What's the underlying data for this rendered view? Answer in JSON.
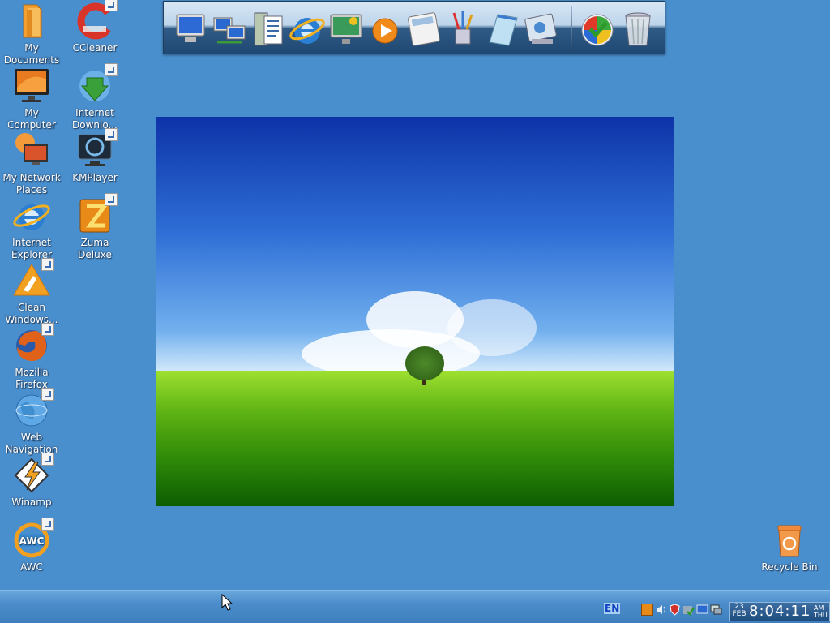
{
  "desktop": {
    "icons": [
      {
        "label": "My\nDocuments",
        "icon": "folder-icon",
        "shortcut": false
      },
      {
        "label": "My Computer",
        "icon": "computer-icon",
        "shortcut": false
      },
      {
        "label": "My Network\nPlaces",
        "icon": "network-icon",
        "shortcut": false
      },
      {
        "label": "Internet\nExplorer",
        "icon": "internet-explorer-icon",
        "shortcut": false
      },
      {
        "label": "Clean\nWindows...",
        "icon": "clean-icon",
        "shortcut": true
      },
      {
        "label": "Mozilla\nFirefox",
        "icon": "firefox-icon",
        "shortcut": true
      },
      {
        "label": "Web\nNavigation",
        "icon": "globe-icon",
        "shortcut": true
      },
      {
        "label": "Winamp",
        "icon": "winamp-icon",
        "shortcut": true
      },
      {
        "label": "AWC",
        "icon": "awc-icon",
        "shortcut": true
      },
      {
        "label": "CCleaner",
        "icon": "ccleaner-icon",
        "shortcut": true
      },
      {
        "label": "Internet\nDownlo...",
        "icon": "download-manager-icon",
        "shortcut": true
      },
      {
        "label": "KMPlayer",
        "icon": "kmplayer-icon",
        "shortcut": true
      },
      {
        "label": "Zuma Deluxe",
        "icon": "zuma-icon",
        "shortcut": true
      },
      {
        "label": "Recycle Bin",
        "icon": "recycle-bin-icon",
        "shortcut": false
      }
    ]
  },
  "dock": {
    "items": [
      {
        "icon": "computer-icon"
      },
      {
        "icon": "network-icon"
      },
      {
        "icon": "documents-icon"
      },
      {
        "icon": "internet-explorer-icon"
      },
      {
        "icon": "display-settings-icon"
      },
      {
        "icon": "media-player-icon"
      },
      {
        "icon": "calculator-icon"
      },
      {
        "icon": "paint-brushes-icon"
      },
      {
        "icon": "notepad-icon"
      },
      {
        "icon": "control-panel-icon"
      },
      {
        "icon": "start-orb-icon"
      },
      {
        "icon": "trash-icon"
      }
    ]
  },
  "taskbar": {
    "language": "EN",
    "clock": {
      "day": "23",
      "month": "FEB",
      "time": "8:04:11",
      "am_pm": "AM",
      "weekday": "THU"
    }
  },
  "colors": {
    "desktop_background": "#4a8fcd",
    "taskbar": "#4b8cca",
    "sky": "#2f6fd6",
    "grass": "#5fb414"
  }
}
